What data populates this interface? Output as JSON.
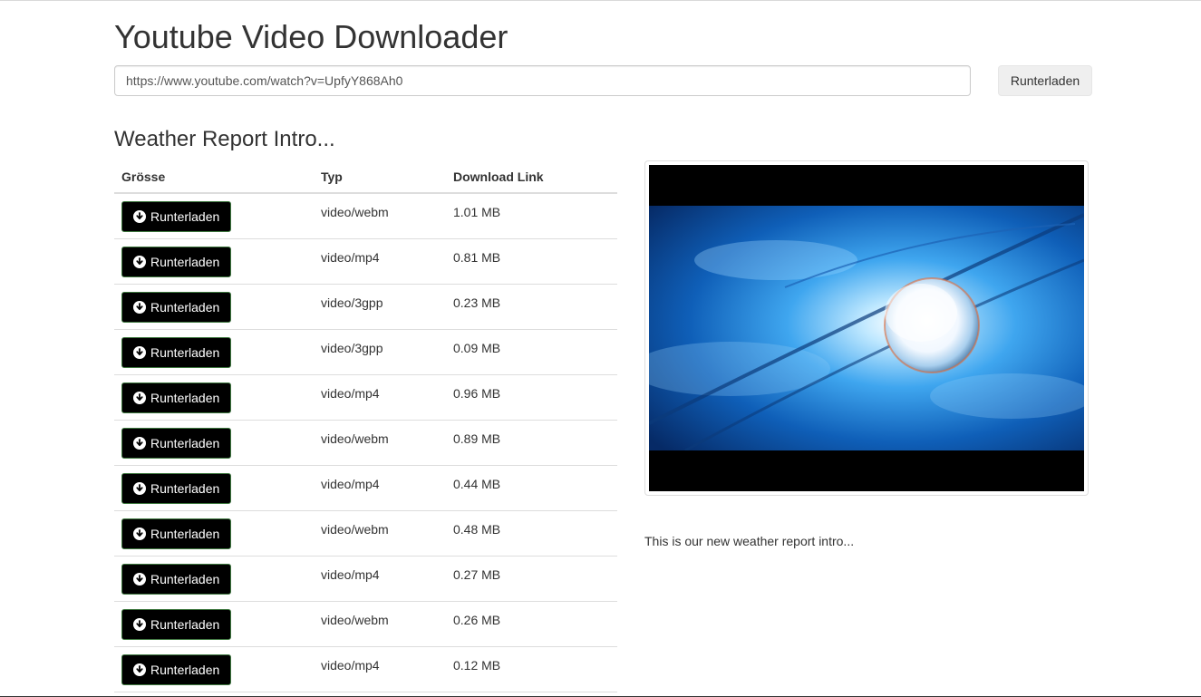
{
  "header": {
    "title": "Youtube Video Downloader"
  },
  "search": {
    "value": "https://www.youtube.com/watch?v=UpfyY868Ah0",
    "button_label": "Runterladen"
  },
  "video": {
    "title": "Weather Report Intro...",
    "description": "This is our new weather report intro...",
    "thumbnail_icon": "video-thumbnail-icon"
  },
  "table": {
    "headers": [
      "Grösse",
      "Typ",
      "Download Link"
    ],
    "button_label": "Runterladen",
    "button_icon": "download-circle-icon",
    "rows": [
      {
        "type": "video/webm",
        "size": "1.01 MB"
      },
      {
        "type": "video/mp4",
        "size": "0.81 MB"
      },
      {
        "type": "video/3gpp",
        "size": "0.23 MB"
      },
      {
        "type": "video/3gpp",
        "size": "0.09 MB"
      },
      {
        "type": "video/mp4",
        "size": "0.96 MB"
      },
      {
        "type": "video/webm",
        "size": "0.89 MB"
      },
      {
        "type": "video/mp4",
        "size": "0.44 MB"
      },
      {
        "type": "video/webm",
        "size": "0.48 MB"
      },
      {
        "type": "video/mp4",
        "size": "0.27 MB"
      },
      {
        "type": "video/webm",
        "size": "0.26 MB"
      },
      {
        "type": "video/mp4",
        "size": "0.12 MB"
      }
    ]
  },
  "colors": {
    "button_bg": "#000000",
    "button_border": "#3c763d",
    "text": "#333333"
  }
}
